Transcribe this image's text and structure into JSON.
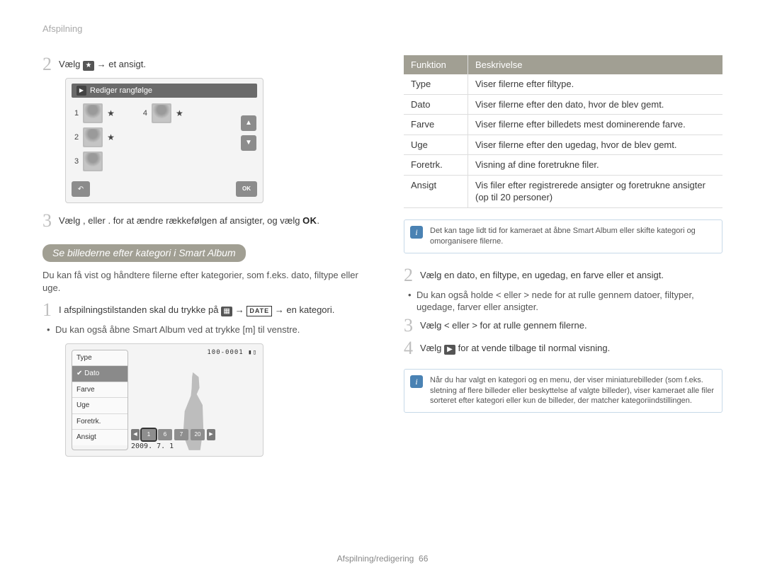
{
  "header": "Afspilning",
  "left": {
    "step2": {
      "a": "Vælg",
      "b": "→ et ansigt."
    },
    "sim_title": "Rediger rangfølge",
    "rank_left": [
      "1",
      "2",
      "3"
    ],
    "rank_right": [
      "4"
    ],
    "step3": {
      "a": "Vælg",
      "b": ",",
      "c": "eller",
      "d": ".",
      "e": "for at ændre rækkefølgen af ansigter, og vælg"
    },
    "pill": "Se billederne efter kategori i Smart Album",
    "intro": "Du kan få vist og håndtere filerne efter kategorier, som f.eks. dato, filtype eller uge.",
    "s1": {
      "a": "I afspilningstilstanden skal du trykke på",
      "b": "→",
      "c": "→ en kategori."
    },
    "s1_bullet": "Du kan også åbne Smart Album ved at trykke [m] til venstre.",
    "cat": [
      "Type",
      "Dato",
      "Farve",
      "Uge",
      "Foretrk.",
      "Ansigt"
    ],
    "counter": "100-0001",
    "thumbs": [
      "1",
      "6",
      "7",
      "20"
    ],
    "date": "2009. 7. 1"
  },
  "right": {
    "th1": "Funktion",
    "th2": "Beskrivelse",
    "rows": [
      {
        "f": "Type",
        "d": "Viser filerne efter filtype."
      },
      {
        "f": "Dato",
        "d": "Viser filerne efter den dato, hvor de blev gemt."
      },
      {
        "f": "Farve",
        "d": "Viser filerne efter billedets mest dominerende farve."
      },
      {
        "f": "Uge",
        "d": "Viser filerne efter den ugedag, hvor de blev gemt."
      },
      {
        "f": "Foretrk.",
        "d": "Visning af dine foretrukne filer."
      },
      {
        "f": "Ansigt",
        "d": "Vis filer efter registrerede ansigter og foretrukne ansigter (op til 20 personer)"
      }
    ],
    "info1": "Det kan tage lidt tid for kameraet at åbne Smart Album eller skifte kategori og omorganisere filerne.",
    "s2": "Vælg en dato, en filtype, en ugedag, en farve eller et ansigt.",
    "s2_bullet": "Du kan også holde < eller > nede for at rulle gennem datoer, filtyper, ugedage, farver eller ansigter.",
    "s3": "Vælg  <  eller >  for at rulle gennem filerne.",
    "s4": {
      "a": "Vælg",
      "b": "for at vende tilbage til normal visning."
    },
    "info2": "Når du har valgt en kategori og en menu, der viser miniaturebilleder (som f.eks. sletning af flere billeder eller beskyttelse af valgte billeder), viser kameraet alle filer sorteret efter kategori eller kun de billeder, der matcher kategoriindstillingen."
  },
  "footer": {
    "a": "Afspilning/redigering",
    "b": "66"
  },
  "date_glyph": "DATE"
}
